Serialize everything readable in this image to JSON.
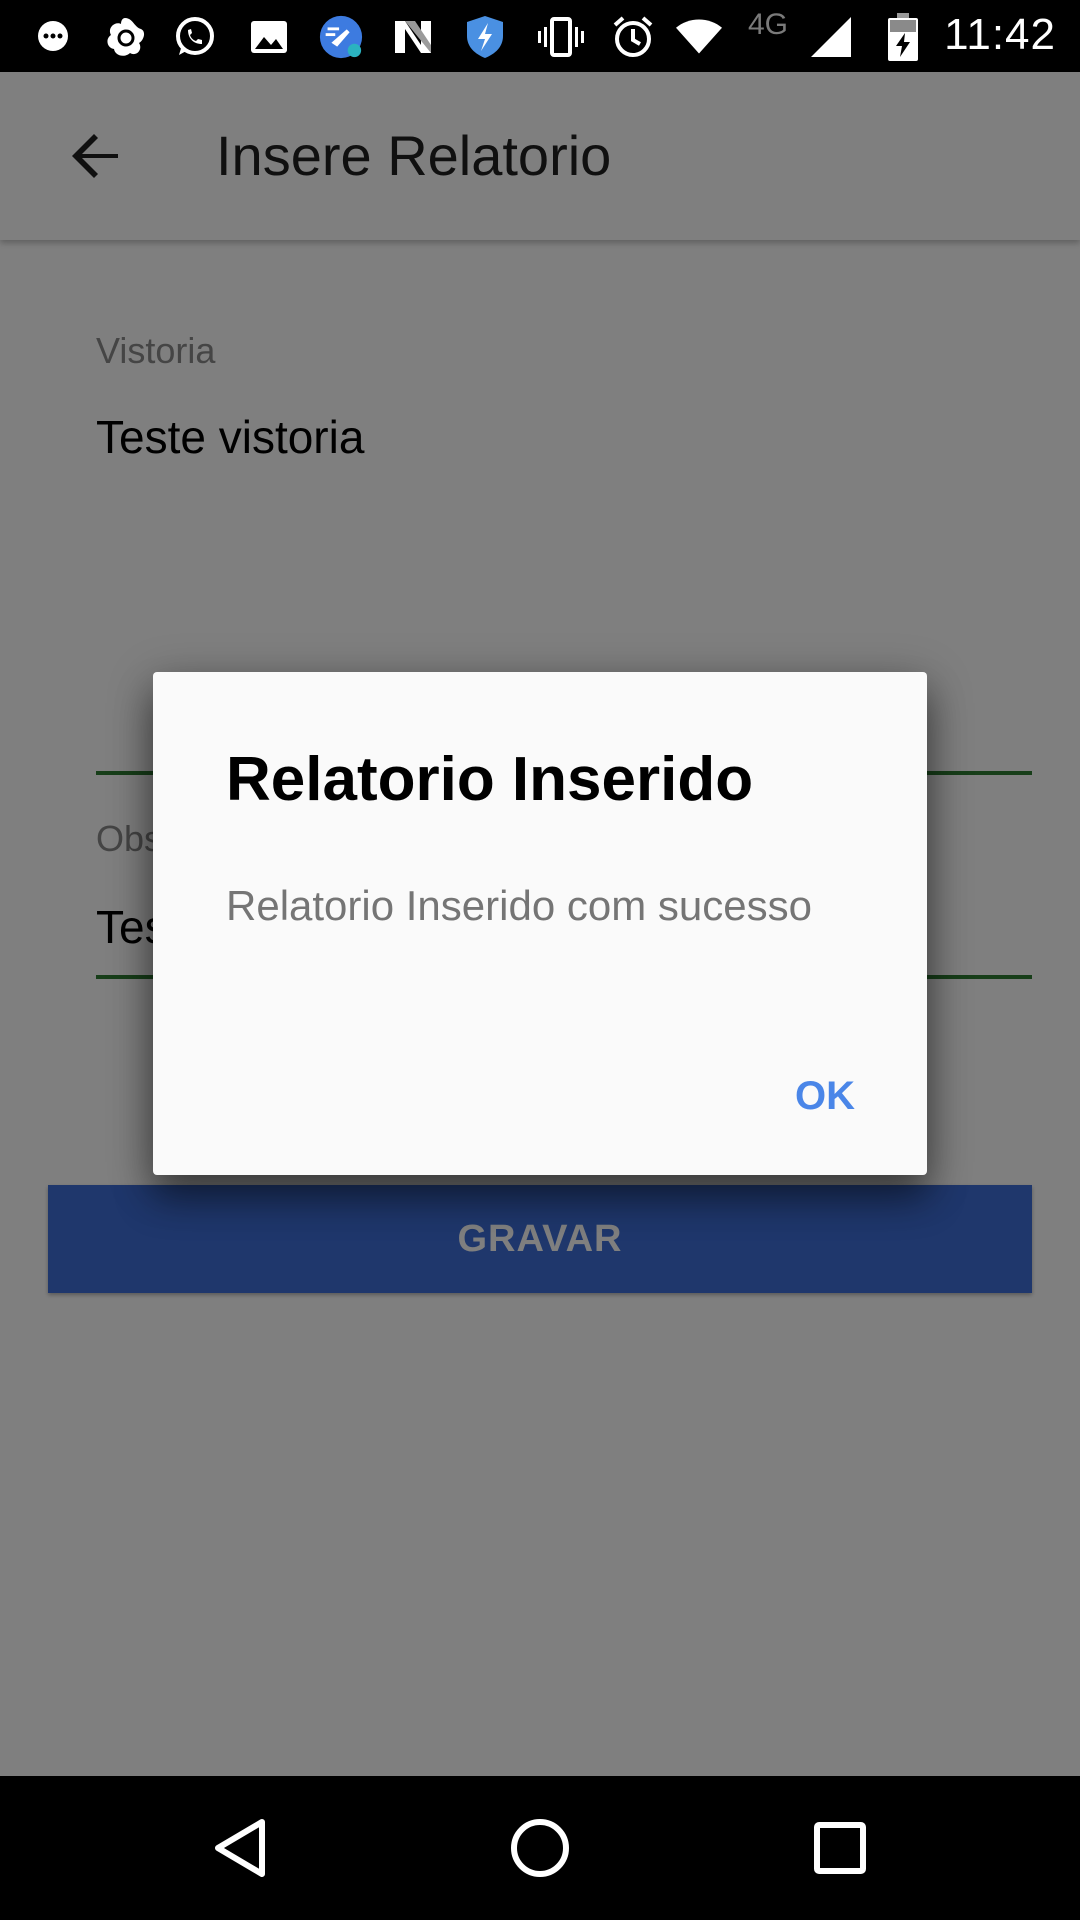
{
  "status_bar": {
    "icons": [
      "messenger-icon",
      "avast-icon",
      "whatsapp-icon",
      "gallery-icon",
      "cleaner-icon",
      "n-app-icon",
      "shield-icon",
      "vibrate-icon",
      "alarm-icon",
      "wifi-icon",
      "cellular-icon",
      "battery-icon"
    ],
    "network_label": "4G",
    "time": "11:42"
  },
  "app_bar": {
    "back_icon": "arrow-back-icon",
    "title": "Insere Relatorio"
  },
  "form": {
    "vistoria": {
      "label": "Vistoria",
      "value": "Teste vistoria"
    },
    "observacao": {
      "label_visible": "Obs",
      "value_visible": "Tes"
    },
    "submit_label": "GRAVAR"
  },
  "dialog": {
    "title": "Relatorio Inserido",
    "message": "Relatorio Inserido com sucesso",
    "ok_label": "OK"
  },
  "nav_bar": {
    "icons": [
      "back-triangle-icon",
      "home-circle-icon",
      "recents-square-icon"
    ]
  },
  "colors": {
    "accent_green": "#2e7d32",
    "button_blue": "#3f6fd8",
    "dialog_action": "#4a86e8"
  }
}
